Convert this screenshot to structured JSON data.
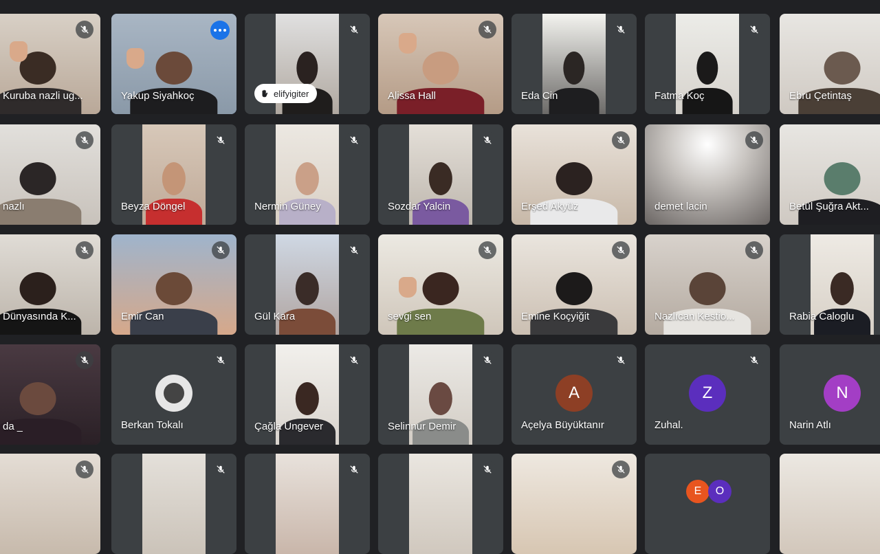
{
  "participants": [
    {
      "name": "Kuruba nazli ug...",
      "muted": true
    },
    {
      "name": "Yakup Siyahkoç",
      "muted": false,
      "selected": true
    },
    {
      "name": "elifyigiter",
      "muted": true,
      "chip": true
    },
    {
      "name": "Alissa Hall",
      "muted": true
    },
    {
      "name": "Eda Cin",
      "muted": true
    },
    {
      "name": "Fatma Koç",
      "muted": true
    },
    {
      "name": "Ebru Çetintaş",
      "muted": true
    },
    {
      "name": "nazlı",
      "muted": true
    },
    {
      "name": "Beyza Döngel",
      "muted": true
    },
    {
      "name": "Nermin Güney",
      "muted": true
    },
    {
      "name": "Sozdar Yalcin",
      "muted": true
    },
    {
      "name": "Erşed Akyüz",
      "muted": true
    },
    {
      "name": "demet lacin",
      "muted": true
    },
    {
      "name": "Betül Şuğra Akt...",
      "muted": true
    },
    {
      "name": "Dünyasında K...",
      "muted": true
    },
    {
      "name": "Emir Can",
      "muted": true
    },
    {
      "name": "Gül Kara",
      "muted": true
    },
    {
      "name": "sevgi sen",
      "muted": true
    },
    {
      "name": "Emine Koçyiğit",
      "muted": true
    },
    {
      "name": "Nazlıcan Kestio...",
      "muted": true
    },
    {
      "name": "Rabia Caloglu",
      "muted": true
    },
    {
      "name": "da _",
      "muted": true
    },
    {
      "name": "Berkan Tokalı",
      "muted": true
    },
    {
      "name": "Çağla Ungever",
      "muted": true
    },
    {
      "name": "Selinnur Demir",
      "muted": true
    },
    {
      "name": "Açelya Büyüktanır",
      "muted": true,
      "avatar": "A",
      "avatar_color": "#8d3f25"
    },
    {
      "name": "Zuhal.",
      "muted": true,
      "avatar": "Z",
      "avatar_color": "#5b2ebd"
    },
    {
      "name": "Narin Atlı",
      "muted": true,
      "avatar": "N",
      "avatar_color": "#a33ec5"
    }
  ],
  "bottom_avatars": [
    "E",
    "O"
  ],
  "colors": {
    "background": "#202124",
    "tile": "#3c4043",
    "selection": "#8ab4f8",
    "more_button": "#1a73e8"
  }
}
